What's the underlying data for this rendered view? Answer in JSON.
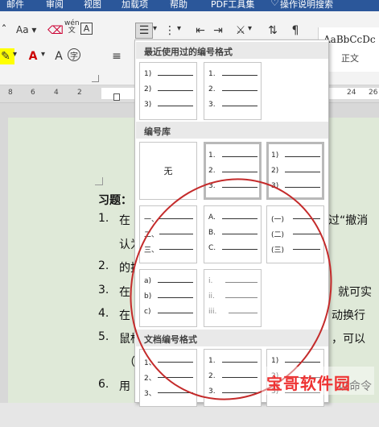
{
  "ribbon_tabs": [
    "邮件",
    "审阅",
    "视图",
    "加载项",
    "帮助",
    "PDF工具集",
    "操作说明搜索"
  ],
  "ribbon": {
    "font_size_label": "Aa",
    "wen_label": "wén\n文",
    "style_sample": "AaBbCcDc",
    "style_name": "正文"
  },
  "ruler_ticks": [
    "8",
    "6",
    "4",
    "2",
    "24",
    "26"
  ],
  "menu": {
    "recent_header": "最近使用过的编号格式",
    "library_header": "编号库",
    "document_header": "文档编号格式",
    "none_label": "无",
    "recent_tiles": [
      [
        "1)",
        "2)",
        "3)"
      ],
      [
        "1.",
        "2.",
        "3."
      ]
    ],
    "library_tiles": [
      [
        "1.",
        "2.",
        "3."
      ],
      [
        "1)",
        "2)",
        "3)"
      ],
      [
        "一、",
        "二、",
        "三、"
      ],
      [
        "A.",
        "B.",
        "C."
      ],
      [
        "(一)",
        "(二)",
        "(三)"
      ],
      [
        "a)",
        "b)",
        "c)"
      ],
      [
        "i.",
        "ii.",
        "iii."
      ]
    ],
    "document_tiles": [
      [
        "1、",
        "2、",
        "3、"
      ],
      [
        "1.",
        "2.",
        "3."
      ],
      [
        "1)",
        "2)",
        "3)"
      ]
    ]
  },
  "document": {
    "heading": "习题：",
    "lines": [
      {
        "num": "1.",
        "text": "在",
        "tail": "过“撤消"
      },
      {
        "num": "",
        "text": "认为",
        "tail": ""
      },
      {
        "num": "2.",
        "text": "的技",
        "tail": ""
      },
      {
        "num": "3.",
        "text": "在",
        "tail": "就可实"
      },
      {
        "num": "4.",
        "text": "在",
        "tail": "动换行"
      },
      {
        "num": "5.",
        "text": "鼠标",
        "tail": "，可以"
      },
      {
        "num": "",
        "text": "（",
        "tail": ""
      },
      {
        "num": "6.",
        "text": "用",
        "tail": "以命令"
      }
    ]
  },
  "watermark": "宝哥软件园",
  "colors": {
    "ribbon_tab_bg": "#2b579a",
    "doc_bg": "#dfe9d8",
    "highlight_circle": "#c42b2b",
    "watermark": "#e33333"
  }
}
